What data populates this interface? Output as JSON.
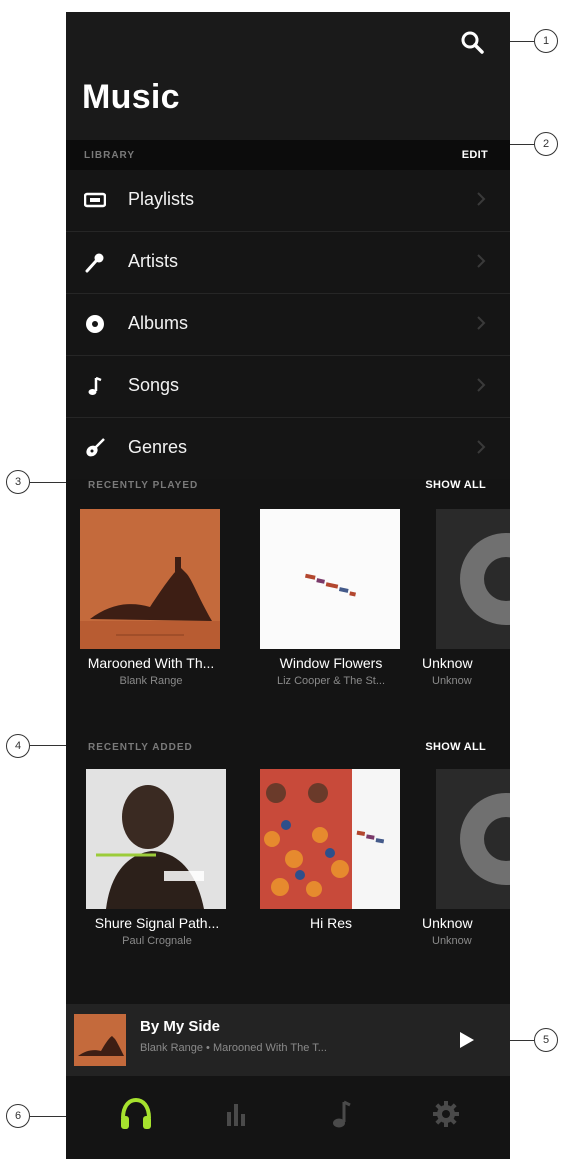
{
  "app": {
    "title": "Music"
  },
  "library": {
    "label": "LIBRARY",
    "edit_label": "EDIT",
    "items": [
      {
        "label": "Playlists",
        "icon": "playlist-icon"
      },
      {
        "label": "Artists",
        "icon": "microphone-icon"
      },
      {
        "label": "Albums",
        "icon": "album-icon"
      },
      {
        "label": "Songs",
        "icon": "music-note-icon"
      },
      {
        "label": "Genres",
        "icon": "guitar-icon"
      }
    ]
  },
  "recently_played": {
    "label": "RECENTLY PLAYED",
    "show_all_label": "SHOW ALL",
    "items": [
      {
        "title": "Marooned With Th...",
        "subtitle": "Blank Range"
      },
      {
        "title": "Window Flowers",
        "subtitle": "Liz Cooper & The St..."
      },
      {
        "title": "Unknow",
        "subtitle": "Unknow"
      }
    ]
  },
  "recently_added": {
    "label": "RECENTLY ADDED",
    "show_all_label": "SHOW ALL",
    "items": [
      {
        "title": "Shure Signal Path...",
        "subtitle": "Paul Crognale"
      },
      {
        "title": "Hi Res",
        "subtitle": ""
      },
      {
        "title": "Unknow",
        "subtitle": "Unknow"
      }
    ]
  },
  "now_playing": {
    "title": "By My Side",
    "subtitle": "Blank Range • Marooned With The T..."
  },
  "tabs": [
    {
      "icon": "headphones-icon",
      "active": true
    },
    {
      "icon": "equalizer-icon",
      "active": false
    },
    {
      "icon": "music-note-icon",
      "active": false
    },
    {
      "icon": "gear-icon",
      "active": false
    }
  ],
  "callouts": [
    "1",
    "2",
    "3",
    "4",
    "5",
    "6"
  ],
  "colors": {
    "accent": "#a6e22e",
    "background": "#141414",
    "header": "#1a1a1a"
  }
}
